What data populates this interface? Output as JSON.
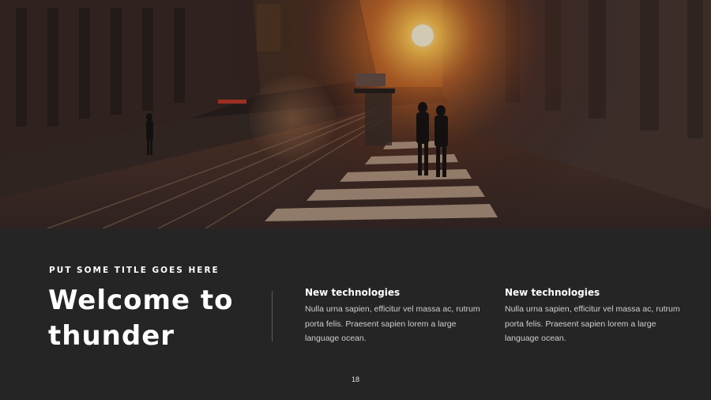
{
  "slide": {
    "kicker": "PUT SOME TITLE GOES HERE",
    "headline_line1": "Welcome to",
    "headline_line2": "thunder",
    "page_number": "18"
  },
  "columns": [
    {
      "title": "New technologies",
      "body": "Nulla urna sapien, efficitur vel massa ac, rutrum porta felis. Praesent sapien lorem a large language ocean."
    },
    {
      "title": "New technologies",
      "body": "Nulla urna sapien, efficitur vel massa ac, rutrum porta felis. Praesent sapien lorem a large language ocean."
    }
  ],
  "colors": {
    "background": "#252525",
    "text": "#ffffff",
    "body_text": "#cfcfcf",
    "sun_glow": "#ffb24a"
  }
}
